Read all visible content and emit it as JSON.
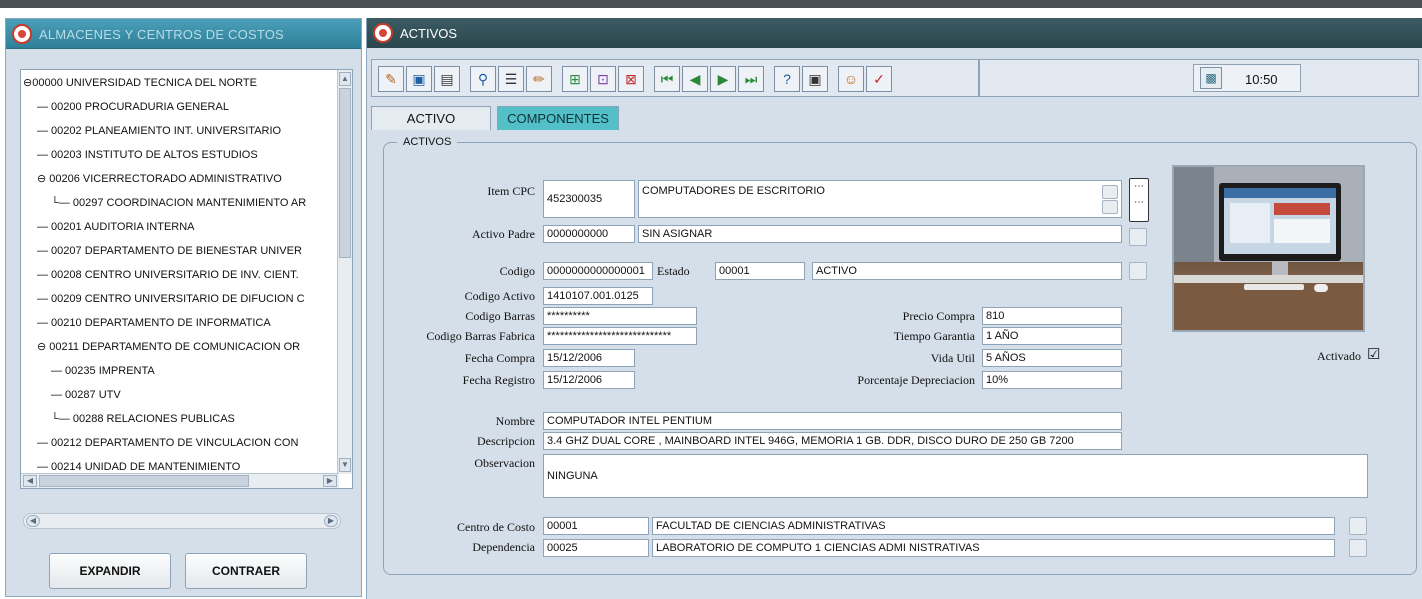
{
  "left": {
    "title": "ALMACENES Y CENTROS DE COSTOS",
    "tree": [
      "⊖00000 UNIVERSIDAD TECNICA DEL NORTE",
      "— 00200 PROCURADURIA GENERAL",
      "— 00202 PLANEAMIENTO INT. UNIVERSITARIO",
      "— 00203 INSTITUTO DE ALTOS ESTUDIOS",
      "⊖ 00206 VICERRECTORADO ADMINISTRATIVO",
      "└— 00297 COORDINACION MANTENIMIENTO AR",
      "— 00201 AUDITORIA INTERNA",
      "— 00207 DEPARTAMENTO DE BIENESTAR UNIVER",
      "— 00208 CENTRO UNIVERSITARIO DE INV. CIENT.",
      "— 00209 CENTRO UNIVERSITARIO DE DIFUCION C",
      "— 00210 DEPARTAMENTO DE INFORMATICA",
      "⊖ 00211 DEPARTAMENTO DE COMUNICACION OR",
      "— 00235 IMPRENTA",
      "— 00287 UTV",
      "└— 00288 RELACIONES PUBLICAS",
      "— 00212 DEPARTAMENTO DE VINCULACION CON",
      "— 00214 UNIDAD DE MANTENIMIENTO"
    ],
    "expand": "EXPANDIR",
    "collapse": "CONTRAER"
  },
  "right": {
    "title": "ACTIVOS",
    "clock": "10:50",
    "tabs": [
      "ACTIVO",
      "COMPONENTES"
    ],
    "legend": "ACTIVOS",
    "labels": {
      "item_cpc": "Item CPC",
      "activo_padre": "Activo Padre",
      "codigo": "Codigo",
      "estado": "Estado",
      "codigo_activo": "Codigo Activo",
      "codigo_barras": "Codigo Barras",
      "codigo_barras_fabrica": "Codigo Barras Fabrica",
      "fecha_compra": "Fecha Compra",
      "fecha_registro": "Fecha Registro",
      "precio_compra": "Precio Compra",
      "tiempo_garantia": "Tiempo Garantia",
      "vida_util": "Vida Util",
      "porcentaje_depreciacion": "Porcentaje Depreciacion",
      "activado": "Activado",
      "nombre": "Nombre",
      "descripcion": "Descripcion",
      "observacion": "Observacion",
      "centro_costo": "Centro de Costo",
      "dependencia": "Dependencia"
    },
    "values": {
      "item_cpc_code": "452300035",
      "item_cpc_desc": "COMPUTADORES DE ESCRITORIO",
      "activo_padre_code": "0000000000",
      "activo_padre_desc": "SIN ASIGNAR",
      "codigo": "0000000000000001",
      "estado_code": "00001",
      "estado_desc": "ACTIVO",
      "codigo_activo": "1410107.001.0125",
      "codigo_barras": "**********",
      "codigo_barras_fabrica": "*****************************",
      "fecha_compra": "15/12/2006",
      "fecha_registro": "15/12/2006",
      "precio_compra": "810",
      "tiempo_garantia": "1 AÑO",
      "vida_util": "5 AÑOS",
      "porcentaje_depreciacion": "10%",
      "nombre": "COMPUTADOR INTEL PENTIUM",
      "descripcion": "3.4 GHZ DUAL CORE , MAINBOARD INTEL 946G,  MEMORIA 1 GB. DDR, DISCO DURO DE 250 GB 7200",
      "observacion": "NINGUNA",
      "centro_costo_code": "00001",
      "centro_costo_desc": "FACULTAD DE CIENCIAS ADMINISTRATIVAS",
      "dependencia_code": "00025",
      "dependencia_desc": "LABORATORIO DE COMPUTO 1 CIENCIAS ADMI NISTRATIVAS"
    },
    "activado_mark": "☑"
  }
}
